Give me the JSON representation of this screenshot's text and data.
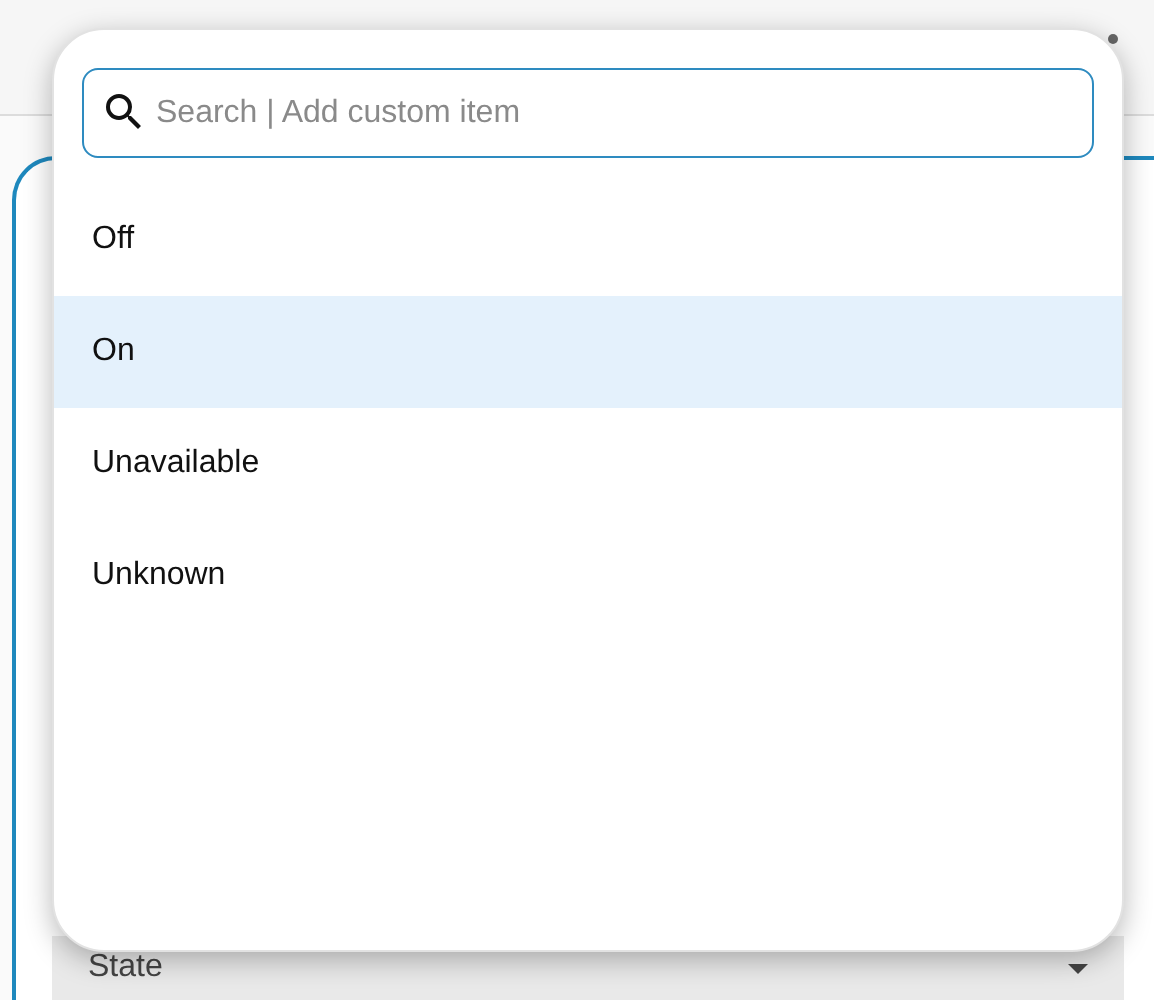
{
  "dropdown": {
    "search": {
      "placeholder": "Search | Add custom item"
    },
    "options": [
      {
        "label": "Off",
        "selected": false
      },
      {
        "label": "On",
        "selected": true
      },
      {
        "label": "Unavailable",
        "selected": false
      },
      {
        "label": "Unknown",
        "selected": false
      }
    ]
  },
  "select_field": {
    "label": "State"
  }
}
